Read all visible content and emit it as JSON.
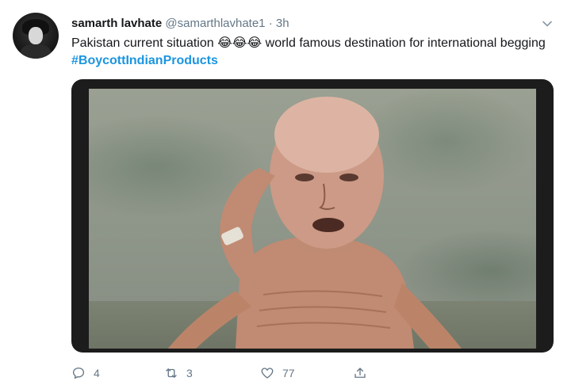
{
  "tweet": {
    "author": {
      "name": "samarth lavhate",
      "handle": "@samarthlavhate1",
      "separator": "·",
      "time": "3h"
    },
    "text": {
      "part1": "Pakistan current situation ",
      "emojis": "😂😂😂",
      "part2": " world famous destination for international begging ",
      "hashtag": "#BoycottIndianProducts"
    },
    "actions": {
      "reply_count": "4",
      "retweet_count": "3",
      "like_count": "77"
    },
    "icons": {
      "reply": "reply-icon",
      "retweet": "retweet-icon",
      "like": "heart-icon",
      "share": "share-icon",
      "more": "chevron-down-icon"
    },
    "colors": {
      "hashtag": "#1b95e0",
      "secondary_text": "#657786"
    }
  }
}
